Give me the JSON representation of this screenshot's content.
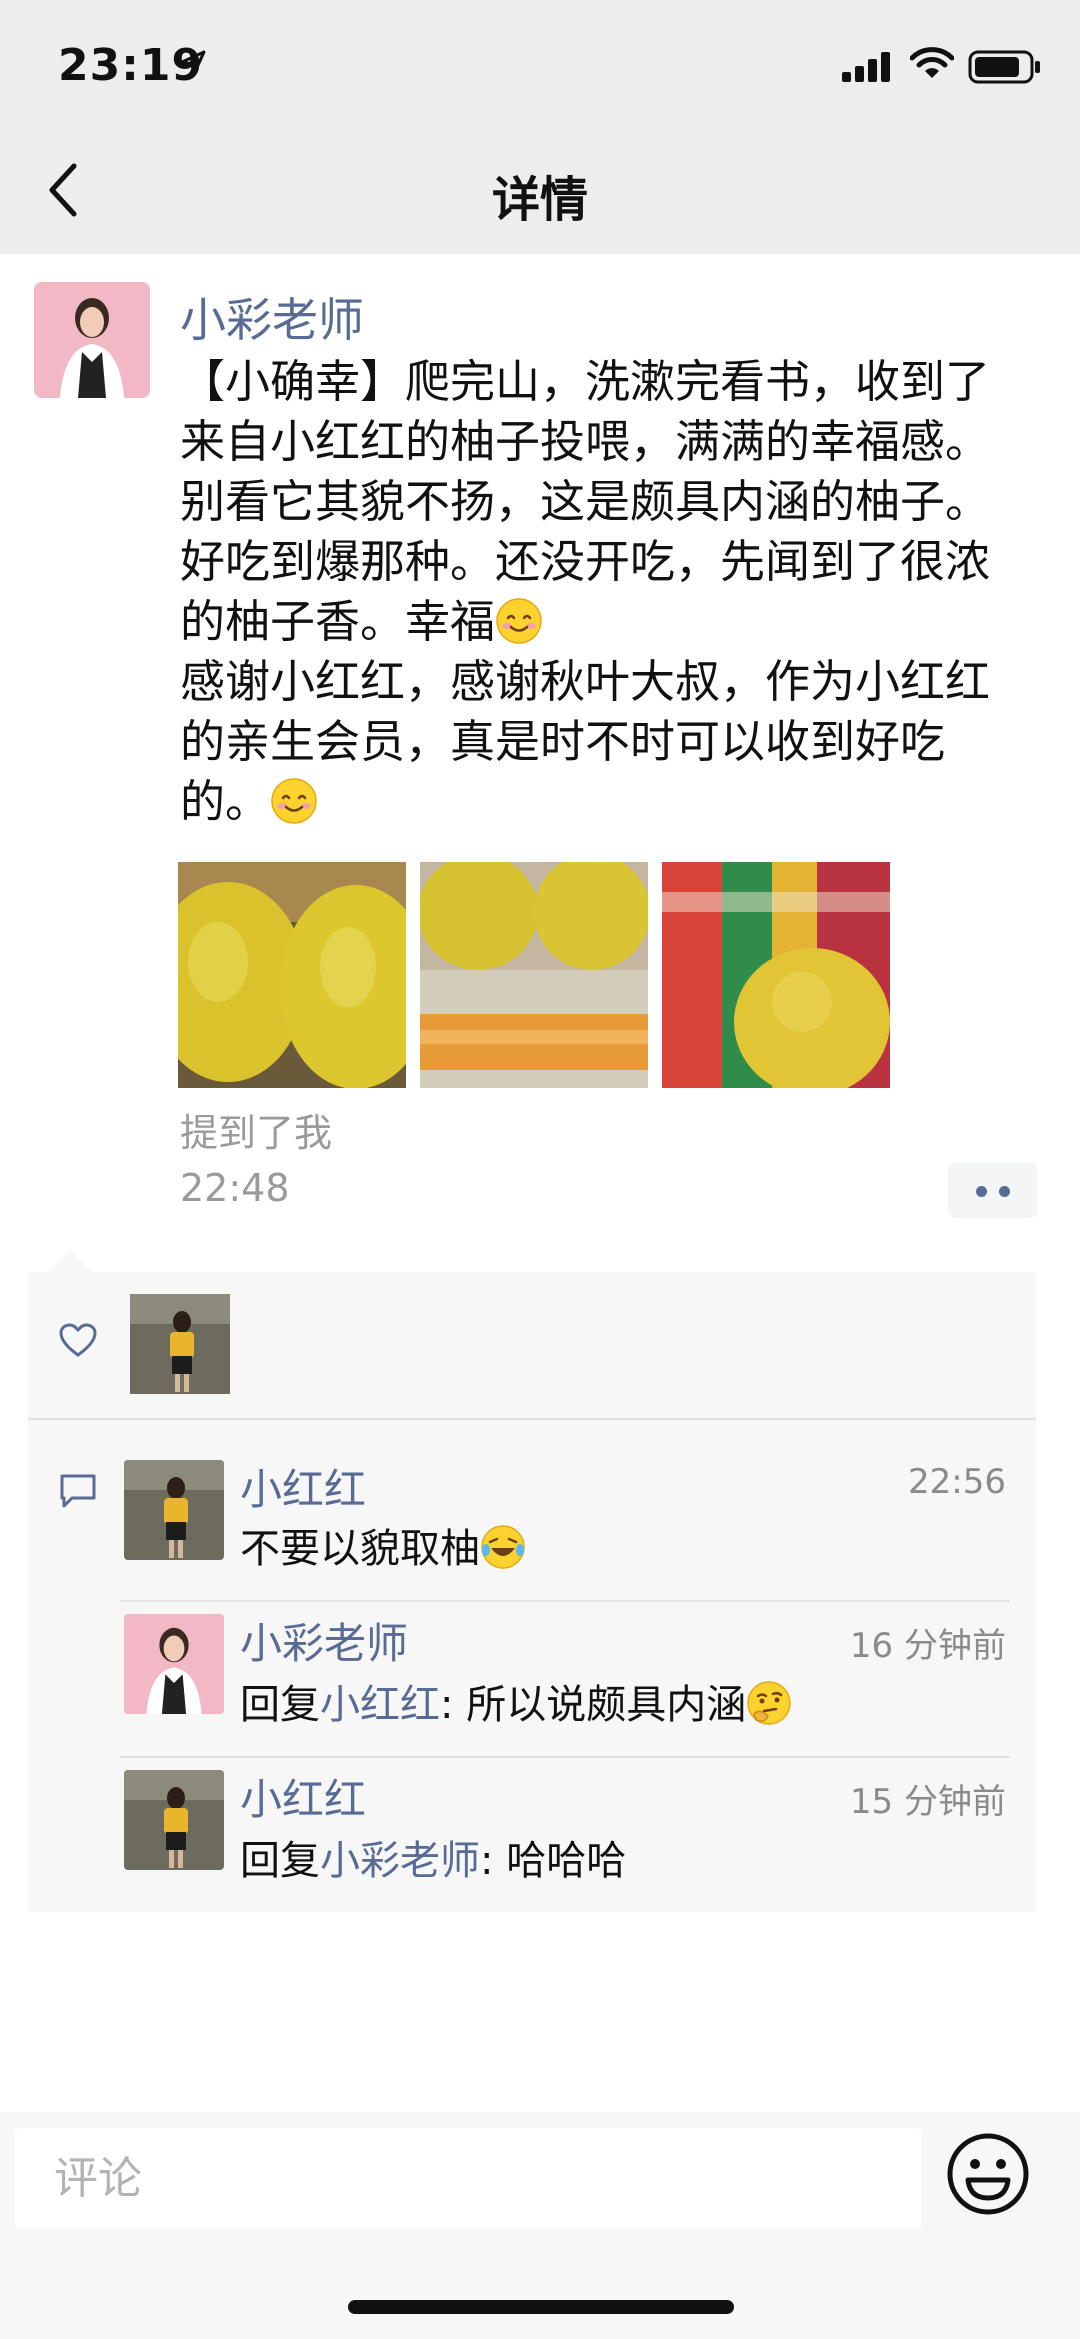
{
  "status_bar": {
    "time": "23:19"
  },
  "nav": {
    "title": "详情"
  },
  "post": {
    "author": "小彩老师",
    "text_part1": "【小确幸】爬完山，洗漱完看书，收到了来自小红红的柚子投喂，满满的幸福感。别看它其貌不扬，这是颇具内涵的柚子。好吃到爆那种。还没开吃，先闻到了很浓的柚子香。幸福",
    "text_part2": "感谢小红红，感谢秋叶大叔，作为小红红的亲生会员，真是时不时可以收到好吃的。",
    "mention": "提到了我",
    "time": "22:48"
  },
  "comments": [
    {
      "name": "小红红",
      "time": "22:56",
      "text": "不要以貌取柚",
      "emoji": "laughing-tears-icon"
    },
    {
      "name": "小彩老师",
      "time": "16 分钟前",
      "reply_prefix": "回复",
      "reply_to": "小红红",
      "text": ": 所以说颇具内涵",
      "emoji": "thinking-face-icon"
    },
    {
      "name": "小红红",
      "time": "15 分钟前",
      "reply_prefix": "回复",
      "reply_to": "小彩老师",
      "text": ": 哈哈哈"
    }
  ],
  "bottom": {
    "comment_placeholder": "评论"
  },
  "colors": {
    "link": "#576b95",
    "nav_bg": "#ededed",
    "panel_bg": "#f7f7f7"
  }
}
